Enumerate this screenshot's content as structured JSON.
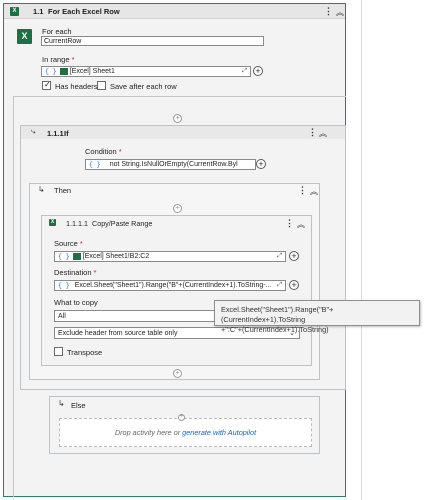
{
  "for_each": {
    "number": "1.1",
    "title": "For Each Excel Row",
    "for_each_label": "For each",
    "for_each_value": "CurrentRow",
    "in_range_label": "In range",
    "in_range_prefix": "{ }",
    "in_range_value": "[Excel] Sheet1",
    "has_headers_label": "Has headers",
    "has_headers_checked": true,
    "save_after_each_row_label": "Save after each row",
    "save_after_each_row_checked": false
  },
  "if_block": {
    "number": "1.1.1",
    "title": "If",
    "condition_label": "Condition",
    "condition_prefix": "{ }",
    "condition_value": "not String.IsNullOrEmpty(CurrentRow.Byl"
  },
  "then_block": {
    "title": "Then"
  },
  "copy_paste": {
    "number": "1.1.1.1",
    "title": "Copy/Paste Range",
    "source_label": "Source",
    "source_prefix": "{ }",
    "source_value": "[Excel] Sheet1!B2:C2",
    "destination_label": "Destination",
    "destination_prefix": "{ }",
    "destination_value": "Excel.Sheet(\"Sheet1\").Range(\"B\"+(CurrentIndex+1).ToString-...",
    "what_to_copy_label": "What to copy",
    "what_to_copy_value": "All",
    "exclude_value": "Exclude header from source table only",
    "transpose_label": "Transpose",
    "transpose_checked": false
  },
  "tooltip": {
    "line1": "Excel.Sheet(\"Sheet1\").Range(\"B\"+(CurrentIndex+1).ToString",
    "line2": "+\":C\"+(CurrentIndex+1).ToString)"
  },
  "else_block": {
    "title": "Else",
    "drop_text": "Drop activity here or",
    "drop_link": "generate with Autopilot"
  },
  "colors": {
    "excel_green": "#1d7044",
    "link_blue": "#1565c0",
    "required_red": "#c62828",
    "canvas_border": "#2e7d6b"
  }
}
